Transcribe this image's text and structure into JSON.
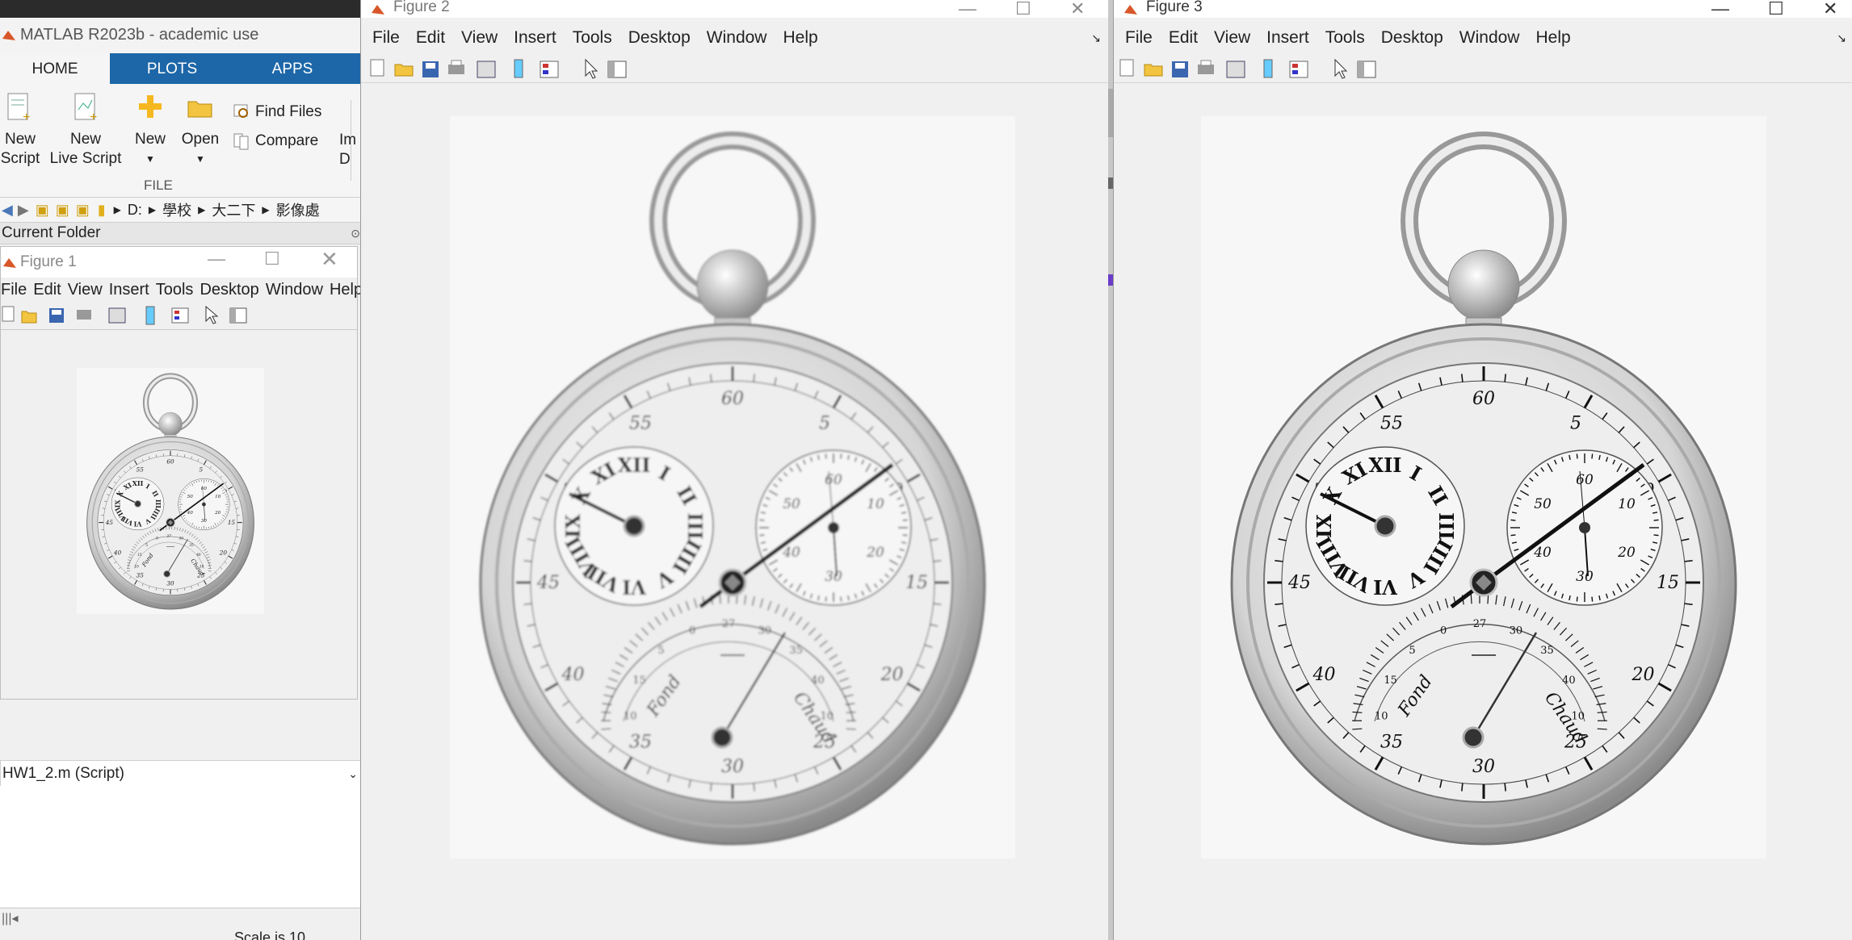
{
  "matlab": {
    "title": "MATLAB R2023b - academic use",
    "tabs": [
      "HOME",
      "PLOTS",
      "APPS"
    ],
    "ribbon": {
      "new_script": [
        "New",
        "Script"
      ],
      "new_live_script": [
        "New",
        "Live Script"
      ],
      "new": "New",
      "open": "Open",
      "find_files": "Find Files",
      "compare": "Compare",
      "import_cut": [
        "Im",
        "D"
      ],
      "section_file": "FILE"
    },
    "path": [
      "D:",
      "學校",
      "大二下",
      "影像處"
    ],
    "current_folder": "Current Folder",
    "script_file": "HW1_2.m  (Script)",
    "bottom_cut": "Scale is 10"
  },
  "figure1": {
    "title": "Figure 1",
    "menu": [
      "File",
      "Edit",
      "View",
      "Insert",
      "Tools",
      "Desktop",
      "Window",
      "Help"
    ]
  },
  "figure2": {
    "title": "Figure 2",
    "menu": [
      "File",
      "Edit",
      "View",
      "Insert",
      "Tools",
      "Desktop",
      "Window",
      "Help"
    ]
  },
  "figure3": {
    "title": "Figure 3",
    "menu": [
      "File",
      "Edit",
      "View",
      "Insert",
      "Tools",
      "Desktop",
      "Window",
      "Help"
    ]
  },
  "watch": {
    "dial_labels": [
      "60",
      "5",
      "10",
      "15",
      "20",
      "25",
      "30",
      "35",
      "40",
      "45",
      "50",
      "55"
    ],
    "roman": [
      "XII",
      "I",
      "II",
      "III",
      "IIII",
      "V",
      "VI",
      "VII",
      "VIII",
      "IX",
      "X",
      "XI"
    ],
    "sub_labels": [
      "60",
      "10",
      "20",
      "30",
      "40",
      "50"
    ],
    "lower_labels": [
      "10",
      "15",
      "5",
      "0",
      "27",
      "30",
      "35",
      "40",
      "10"
    ],
    "fond": "Fond",
    "chaud": "Chaud"
  },
  "colors": {
    "ribbon_blue": "#1d67a8",
    "titlebar_dark": "#2b2b2b"
  }
}
